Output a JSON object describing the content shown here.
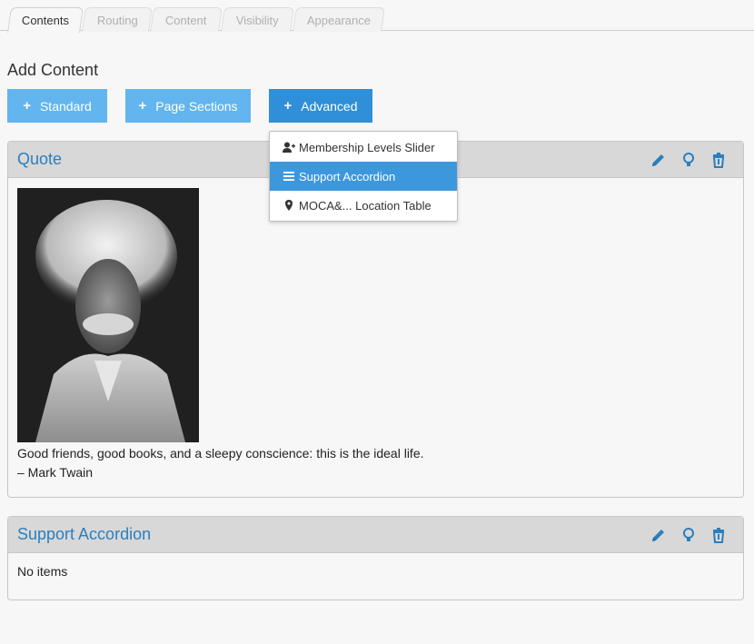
{
  "tabs": [
    {
      "label": "Contents",
      "active": true
    },
    {
      "label": "Routing",
      "active": false
    },
    {
      "label": "Content",
      "active": false
    },
    {
      "label": "Visibility",
      "active": false
    },
    {
      "label": "Appearance",
      "active": false
    }
  ],
  "add_content": {
    "title": "Add Content",
    "buttons": [
      {
        "label": "Standard",
        "icon": "plus-icon"
      },
      {
        "label": "Page Sections",
        "icon": "plus-icon"
      },
      {
        "label": "Advanced",
        "icon": "plus-icon"
      }
    ]
  },
  "dropdown": {
    "items": [
      {
        "label": "Membership Levels Slider",
        "icon": "user-plus-icon",
        "highlighted": false
      },
      {
        "label": "Support Accordion",
        "icon": "list-icon",
        "highlighted": true
      },
      {
        "label": "MOCA&... Location Table",
        "icon": "map-marker-icon",
        "highlighted": false
      }
    ]
  },
  "panels": {
    "quote": {
      "title": "Quote",
      "image": "mark-twain-portrait",
      "quote_text": "Good friends, good books, and a sleepy conscience: this is the ideal life.",
      "attribution": "– Mark Twain"
    },
    "support": {
      "title": "Support Accordion",
      "body": "No items"
    }
  },
  "colors": {
    "accent": "#2a7fc0",
    "button": "#62b5ee",
    "button_active": "#2f8fd8",
    "dropdown_highlight": "#3d97dd",
    "panel_header": "#d8d8d8"
  }
}
